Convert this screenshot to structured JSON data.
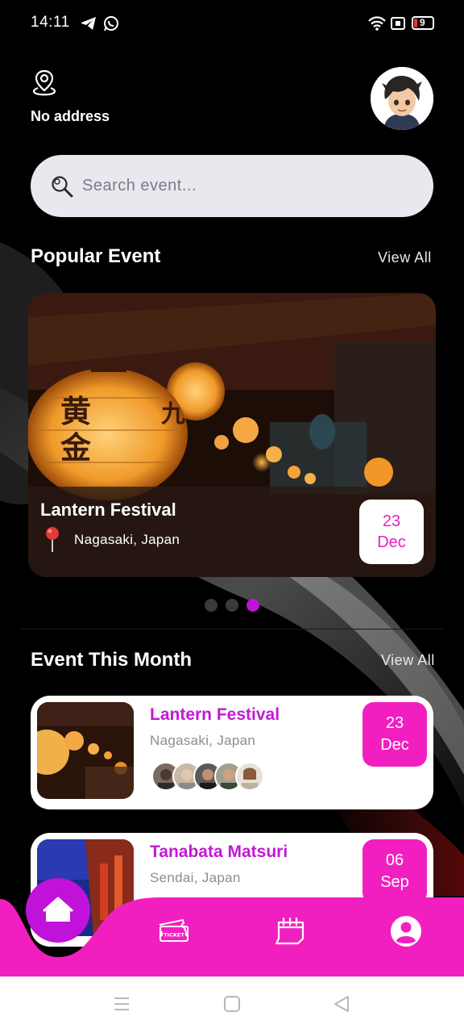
{
  "status_bar": {
    "time": "14:11",
    "battery": "9"
  },
  "header": {
    "address": "No address"
  },
  "search": {
    "placeholder": "Search event..."
  },
  "popular": {
    "section_title": "Popular Event",
    "view_all": "View All",
    "card": {
      "title": "Lantern Festival",
      "location": "Nagasaki, Japan",
      "day": "23",
      "month": "Dec"
    },
    "carousel": {
      "total": 3,
      "active": 3
    }
  },
  "this_month": {
    "section_title": "Event This Month",
    "view_all": "View All",
    "events": [
      {
        "title": "Lantern Festival",
        "location": "Nagasaki, Japan",
        "day": "23",
        "month": "Dec"
      },
      {
        "title": "Tanabata Matsuri",
        "location": "Sendai, Japan",
        "day": "06",
        "month": "Sep"
      }
    ]
  },
  "bottom_nav": {
    "items": [
      "home-icon",
      "ticket-icon",
      "calendar-icon",
      "profile-icon"
    ],
    "ticket_text": "TICKET",
    "accent": "#f21fc0",
    "active": "#c012d8"
  },
  "system_nav": [
    "menu-icon",
    "home-square-icon",
    "back-icon"
  ]
}
